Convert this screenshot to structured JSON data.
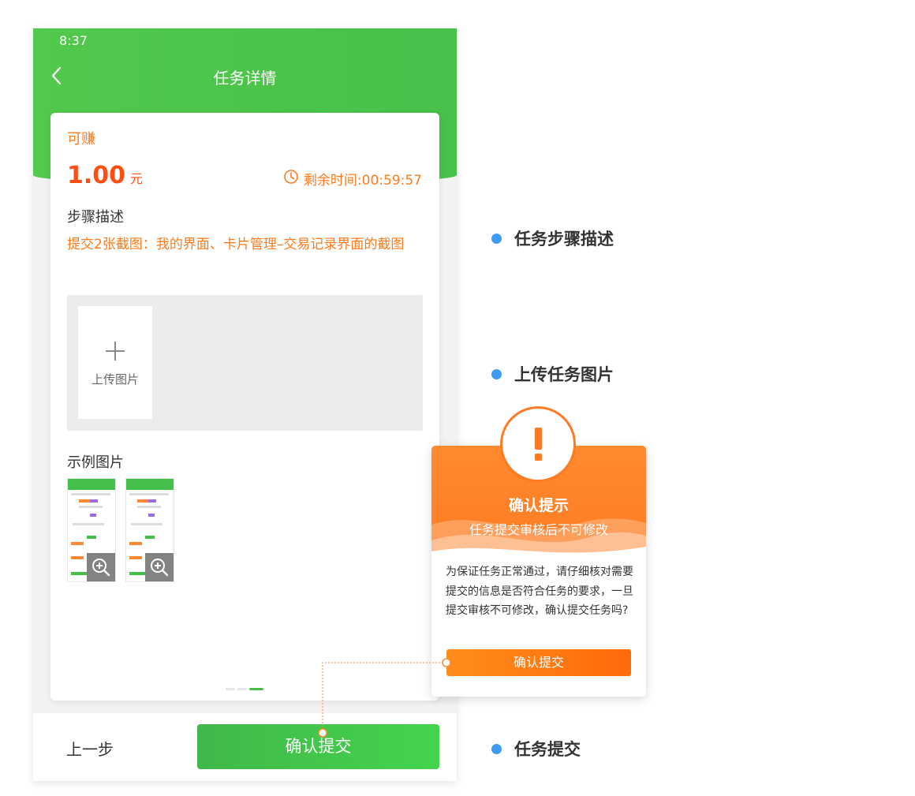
{
  "status_bar": {
    "time": "8:37"
  },
  "nav": {
    "title": "任务详情",
    "back_icon": "chevron-left-icon"
  },
  "task": {
    "earn_label": "可赚",
    "amount": "1.00",
    "amount_unit": "元",
    "remaining_time": "剩余时间:00:59:57",
    "timer_icon": "clock-icon",
    "step_title": "步骤描述",
    "step_description": "提交2张截图：我的界面、卡片管理–交易记录界面的截图",
    "upload_label": "上传图片",
    "example_title": "示例图片",
    "pager": {
      "total": 3,
      "active_index": 2
    }
  },
  "footer": {
    "prev_label": "上一步",
    "submit_label": "确认提交"
  },
  "annotations": [
    "任务步骤描述",
    "上传任务图片",
    "任务提交"
  ],
  "dialog": {
    "title": "确认提示",
    "subtitle": "任务提交审核后不可修改",
    "body": "为保证任务正常通过，请仔细核对需要提交的信息是否符合任务的要求，一旦提交审核不可修改，确认提交任务吗?",
    "button_label": "确认提交",
    "icon": "exclamation-icon"
  },
  "colors": {
    "primary_green": "#45c04a",
    "accent_orange": "#ff7a1a",
    "amount_red": "#ff4e14",
    "annotation_blue": "#3d9bf5"
  }
}
